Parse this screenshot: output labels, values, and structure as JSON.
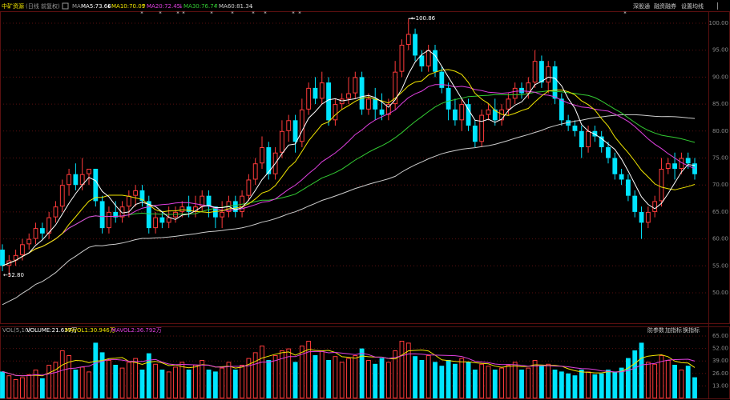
{
  "header": {
    "stock_name": "中矿资源",
    "period_note": "(日线 前复权)",
    "ma_tag": "MA",
    "ma_labels": [
      {
        "text": "MA5:73.66",
        "color": "#ffffff"
      },
      {
        "text": "MA10:70.09",
        "color": "#f2e600"
      },
      {
        "text": "MA20:72.45",
        "color": "#e040e0"
      },
      {
        "text": "MA30:76.74",
        "color": "#33cc33"
      },
      {
        "text": "MA60:81.34",
        "color": "#cccccc"
      }
    ],
    "right_buttons": [
      "深股通",
      "融资融券",
      "设置均线"
    ]
  },
  "volume_header": {
    "labels": [
      {
        "text": "VOL(5,10)",
        "color": "#999999"
      },
      {
        "text": "VOLUME:21.637万",
        "color": "#ffffff"
      },
      {
        "text": "MAVOL1:30.946万",
        "color": "#f2e600"
      },
      {
        "text": "MAVOL2:36.792万",
        "color": "#e040e0"
      }
    ],
    "right_buttons": [
      "防参数",
      "加指标",
      "换指标"
    ]
  },
  "colors": {
    "up": "#ff3b3b",
    "down": "#00e5ff",
    "grid": "#5a1010",
    "axis_text": "#8a8a8a",
    "ma5": "#ffffff",
    "ma10": "#f2e600",
    "ma20": "#e040e0",
    "ma30": "#33cc33",
    "ma60": "#cccccc"
  },
  "chart_data": {
    "type": "candlestick",
    "price_axis": {
      "ticks": [
        "100.00",
        "95.00",
        "90.00",
        "85.00",
        "80.00",
        "75.00",
        "70.00",
        "65.00",
        "60.00",
        "55.00",
        "50.00"
      ],
      "ylim": [
        46,
        101
      ]
    },
    "volume_axis": {
      "ticks": [
        "65.00",
        "52.00",
        "39.00",
        "26.00",
        "13.00"
      ],
      "ylim": [
        0,
        66
      ]
    },
    "annotations": {
      "high": "100.86",
      "low": "52.80"
    },
    "candles": [
      [
        58,
        55,
        59,
        54
      ],
      [
        55,
        56,
        57,
        53
      ],
      [
        56,
        57,
        58,
        55
      ],
      [
        57,
        59,
        60,
        56
      ],
      [
        59,
        60,
        61,
        58
      ],
      [
        60,
        62,
        63,
        59
      ],
      [
        62,
        61,
        63,
        60
      ],
      [
        61,
        64,
        65,
        60
      ],
      [
        64,
        66,
        67,
        63
      ],
      [
        66,
        70,
        71,
        65
      ],
      [
        70,
        72,
        73,
        68
      ],
      [
        72,
        70,
        74,
        69
      ],
      [
        70,
        72,
        75,
        69
      ],
      [
        72,
        73,
        73,
        70
      ],
      [
        73,
        67,
        73,
        66
      ],
      [
        67,
        62,
        68,
        61
      ],
      [
        62,
        65,
        66,
        61
      ],
      [
        65,
        64,
        67,
        63
      ],
      [
        64,
        66,
        67,
        63
      ],
      [
        66,
        68,
        69,
        64
      ],
      [
        68,
        69,
        70,
        66
      ],
      [
        69,
        67,
        70,
        66
      ],
      [
        67,
        62,
        68,
        61
      ],
      [
        62,
        64,
        65,
        61
      ],
      [
        64,
        63,
        65,
        62
      ],
      [
        63,
        64,
        66,
        62
      ],
      [
        64,
        65,
        66,
        63
      ],
      [
        65,
        66,
        67,
        64
      ],
      [
        66,
        65,
        68,
        64
      ],
      [
        65,
        66,
        68,
        64
      ],
      [
        66,
        68,
        69,
        65
      ],
      [
        68,
        66,
        69,
        64
      ],
      [
        66,
        64,
        66,
        62
      ],
      [
        64,
        65,
        67,
        62
      ],
      [
        65,
        67,
        68,
        64
      ],
      [
        67,
        65,
        68,
        64
      ],
      [
        65,
        68,
        69,
        64
      ],
      [
        68,
        71,
        72,
        67
      ],
      [
        71,
        74,
        75,
        70
      ],
      [
        74,
        77,
        79,
        73
      ],
      [
        77,
        72,
        78,
        71
      ],
      [
        72,
        76,
        77,
        71
      ],
      [
        76,
        80,
        82,
        75
      ],
      [
        80,
        82,
        83,
        78
      ],
      [
        82,
        78,
        83,
        76
      ],
      [
        78,
        84,
        86,
        77
      ],
      [
        84,
        88,
        89,
        83
      ],
      [
        88,
        86,
        90,
        85
      ],
      [
        86,
        89,
        91,
        85
      ],
      [
        89,
        82,
        90,
        81
      ],
      [
        82,
        85,
        86,
        81
      ],
      [
        85,
        86,
        87,
        84
      ],
      [
        86,
        87,
        90,
        85
      ],
      [
        87,
        90,
        91,
        86
      ],
      [
        90,
        84,
        91,
        83
      ],
      [
        84,
        86,
        87,
        83
      ],
      [
        86,
        84,
        88,
        82
      ],
      [
        84,
        83,
        87,
        82
      ],
      [
        83,
        85,
        86,
        82
      ],
      [
        85,
        91,
        93,
        84
      ],
      [
        91,
        96,
        97,
        90
      ],
      [
        96,
        98,
        100.86,
        95
      ],
      [
        98,
        94,
        99,
        93
      ],
      [
        94,
        92,
        95,
        91
      ],
      [
        92,
        95,
        96,
        91
      ],
      [
        95,
        91,
        96,
        90
      ],
      [
        91,
        88,
        92,
        87
      ],
      [
        88,
        84,
        89,
        82
      ],
      [
        84,
        82,
        86,
        81
      ],
      [
        82,
        85,
        86,
        80
      ],
      [
        85,
        81,
        86,
        80
      ],
      [
        81,
        78,
        82,
        77
      ],
      [
        78,
        83,
        84,
        77
      ],
      [
        83,
        84,
        85,
        82
      ],
      [
        84,
        82,
        86,
        81
      ],
      [
        82,
        84,
        85,
        81
      ],
      [
        84,
        86,
        87,
        83
      ],
      [
        86,
        88,
        89,
        85
      ],
      [
        88,
        87,
        89,
        86
      ],
      [
        87,
        89,
        90,
        86
      ],
      [
        89,
        93,
        95,
        88
      ],
      [
        93,
        89,
        94,
        88
      ],
      [
        89,
        92,
        93,
        87
      ],
      [
        92,
        86,
        93,
        85
      ],
      [
        86,
        82,
        87,
        81
      ],
      [
        82,
        81,
        83,
        80
      ],
      [
        81,
        80,
        82,
        79
      ],
      [
        80,
        77,
        81,
        75
      ],
      [
        77,
        80,
        81,
        76
      ],
      [
        80,
        79,
        81,
        78
      ],
      [
        79,
        77,
        80,
        76
      ],
      [
        77,
        75,
        78,
        74
      ],
      [
        75,
        72,
        76,
        71
      ],
      [
        72,
        71,
        73,
        70
      ],
      [
        71,
        68,
        72,
        67
      ],
      [
        68,
        65,
        69,
        64
      ],
      [
        65,
        63,
        66,
        60
      ],
      [
        63,
        65,
        66,
        62
      ],
      [
        65,
        67,
        68,
        64
      ],
      [
        67,
        73,
        75,
        66
      ],
      [
        73,
        74,
        75,
        72
      ],
      [
        74,
        73,
        76,
        71
      ],
      [
        73,
        75,
        76,
        72
      ],
      [
        75,
        74,
        76,
        73
      ],
      [
        74,
        72,
        75,
        71
      ]
    ],
    "volume": [
      28,
      24,
      20,
      22,
      25,
      30,
      21,
      35,
      38,
      50,
      45,
      30,
      33,
      28,
      58,
      48,
      40,
      35,
      32,
      38,
      42,
      30,
      47,
      36,
      30,
      28,
      33,
      38,
      30,
      35,
      40,
      30,
      28,
      32,
      38,
      30,
      35,
      42,
      48,
      55,
      40,
      45,
      50,
      52,
      38,
      55,
      60,
      45,
      50,
      40,
      44,
      38,
      42,
      45,
      52,
      40,
      36,
      42,
      38,
      50,
      60,
      58,
      44,
      40,
      45,
      38,
      34,
      40,
      36,
      42,
      38,
      30,
      36,
      34,
      30,
      32,
      35,
      38,
      30,
      32,
      40,
      34,
      36,
      30,
      28,
      26,
      24,
      30,
      28,
      25,
      26,
      30,
      28,
      32,
      42,
      50,
      58,
      38,
      36,
      45,
      40,
      35,
      30,
      34,
      22
    ]
  }
}
